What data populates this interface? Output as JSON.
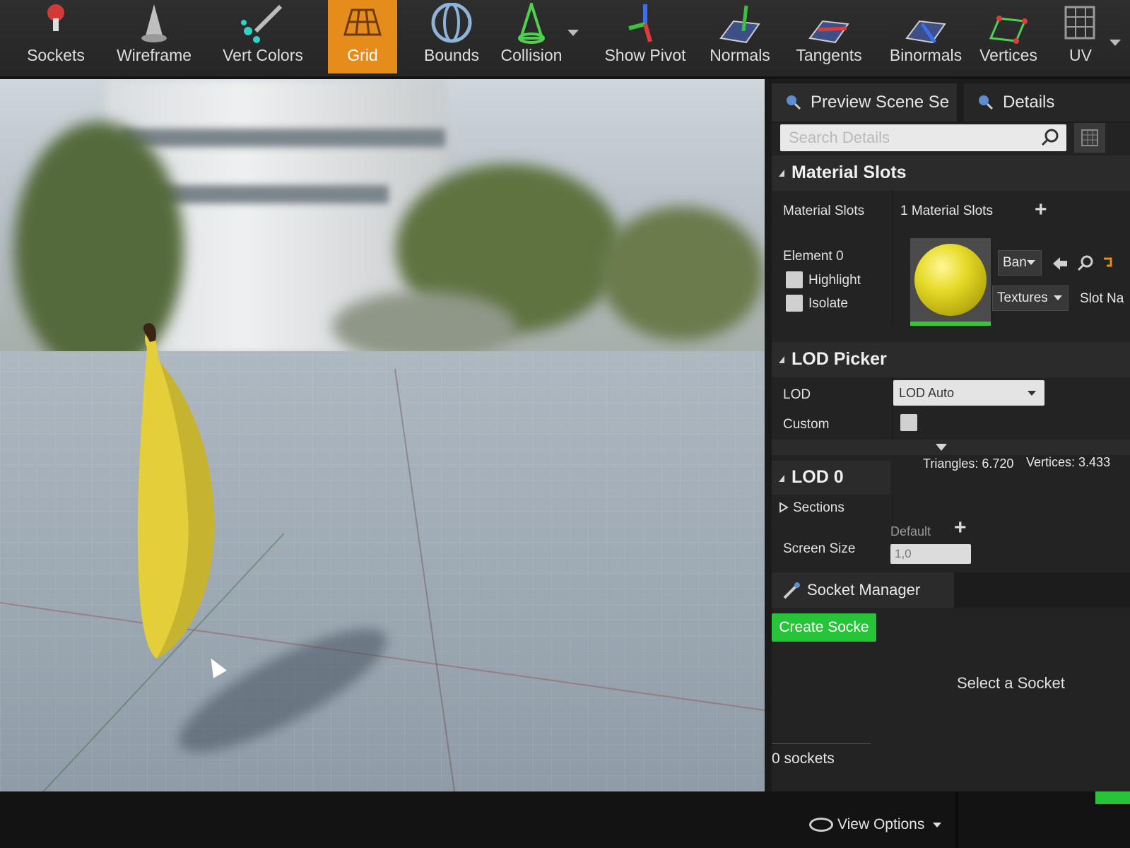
{
  "toolbar": {
    "items": [
      {
        "label": "Sockets",
        "icon": "sockets-icon"
      },
      {
        "label": "Wireframe",
        "icon": "wireframe-icon"
      },
      {
        "label": "Vert Colors",
        "icon": "vert-colors-icon"
      },
      {
        "label": "Grid",
        "icon": "grid-icon",
        "active": true
      },
      {
        "label": "Bounds",
        "icon": "bounds-icon"
      },
      {
        "label": "Collision",
        "icon": "collision-icon"
      },
      {
        "label": "Show Pivot",
        "icon": "pivot-icon"
      },
      {
        "label": "Normals",
        "icon": "normals-icon"
      },
      {
        "label": "Tangents",
        "icon": "tangents-icon"
      },
      {
        "label": "Binormals",
        "icon": "binormals-icon"
      },
      {
        "label": "Vertices",
        "icon": "vertices-icon"
      },
      {
        "label": "UV",
        "icon": "uv-icon"
      }
    ],
    "active_color": "#e58c1a"
  },
  "panel": {
    "tabs": [
      {
        "label": "Preview Scene Se"
      },
      {
        "label": "Details"
      }
    ],
    "search_placeholder": "Search Details",
    "material_slots": {
      "title": "Material Slots",
      "row_label": "Material Slots",
      "count": "1 Material Slots",
      "element_label": "Element 0",
      "highlight_label": "Highlight",
      "isolate_label": "Isolate",
      "material_dd": "Ban",
      "textures_dd": "Textures",
      "slot_name": "Slot Na"
    },
    "lod_picker": {
      "title": "LOD Picker",
      "lod_label": "LOD",
      "lod_value": "LOD Auto",
      "custom_label": "Custom"
    },
    "lod0": {
      "title": "LOD 0",
      "triangles": "Triangles: 6.720",
      "vertices": "Vertices: 3.433",
      "sections_label": "Sections",
      "screen_size_label": "Screen Size",
      "default_label": "Default",
      "screen_size_value": "1,0"
    },
    "socket_manager": {
      "title": "Socket Manager",
      "create_button": "Create Socke",
      "select_hint": "Select a Socket",
      "count": "0 sockets"
    }
  },
  "bottom": {
    "view_options": "View Options"
  },
  "colors": {
    "create_button": "#27c43a",
    "panel_bg": "#232323",
    "banana": "#e4cf3a"
  }
}
